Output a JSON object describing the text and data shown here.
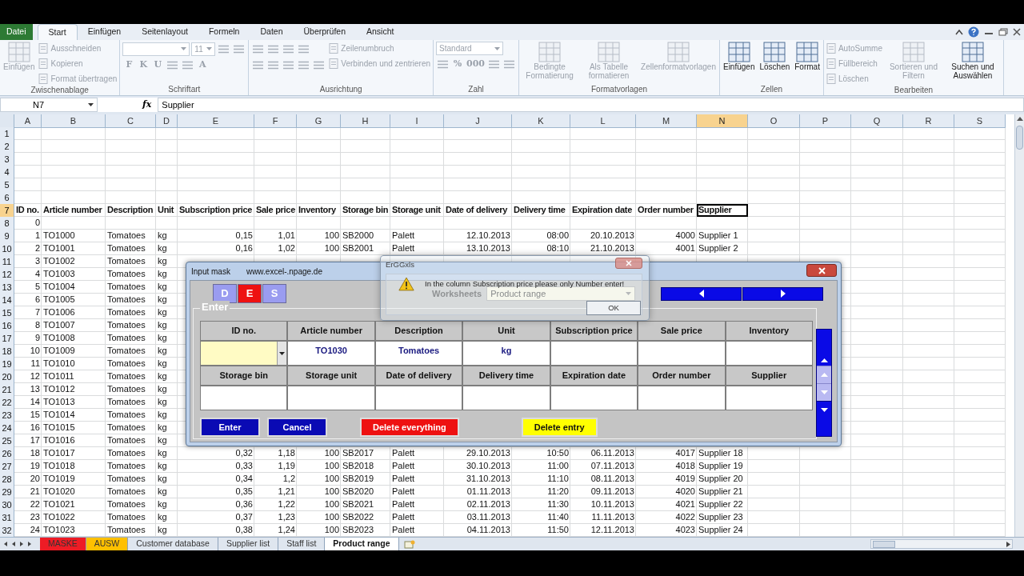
{
  "ribbon": {
    "tabs": [
      {
        "label": "Datei",
        "kind": "file",
        "selected": false
      },
      {
        "label": "Start",
        "kind": "tab",
        "selected": true
      },
      {
        "label": "Einfügen",
        "kind": "tab",
        "selected": false
      },
      {
        "label": "Seitenlayout",
        "kind": "tab",
        "selected": false
      },
      {
        "label": "Formeln",
        "kind": "tab",
        "selected": false
      },
      {
        "label": "Daten",
        "kind": "tab",
        "selected": false
      },
      {
        "label": "Überprüfen",
        "kind": "tab",
        "selected": false
      },
      {
        "label": "Ansicht",
        "kind": "tab",
        "selected": false
      }
    ],
    "groups": [
      {
        "name": "Zwischenablage",
        "columns": [
          [
            [
              {
                "kind": "large",
                "label": "Einfügen",
                "disabled": true
              }
            ]
          ],
          [
            [
              {
                "kind": "small",
                "label": "Ausschneiden",
                "disabled": true
              }
            ],
            [
              {
                "kind": "small",
                "label": "Kopieren",
                "disabled": true
              }
            ],
            [
              {
                "kind": "small",
                "label": "Format übertragen",
                "disabled": true
              }
            ]
          ]
        ]
      },
      {
        "name": "Schriftart",
        "columns": [
          [
            [
              {
                "kind": "combo",
                "disabled": true
              },
              {
                "kind": "short_combo",
                "value": "11",
                "disabled": true
              },
              {
                "kind": "iconbtn",
                "disabled": true
              },
              {
                "kind": "iconbtn",
                "disabled": true
              }
            ],
            [
              {
                "kind": "glyph",
                "label": "F",
                "disabled": true
              },
              {
                "kind": "glyph",
                "label": "K",
                "disabled": true
              },
              {
                "kind": "glyph",
                "label": "U",
                "disabled": true
              },
              {
                "kind": "iconbtn",
                "disabled": true
              },
              {
                "kind": "iconbtn",
                "disabled": true
              },
              {
                "kind": "glyph",
                "label": "A",
                "disabled": true
              }
            ]
          ]
        ]
      },
      {
        "name": "Ausrichtung",
        "columns": [
          [
            [
              {
                "kind": "iconbtn",
                "disabled": true
              },
              {
                "kind": "iconbtn",
                "disabled": true
              },
              {
                "kind": "iconbtn",
                "disabled": true
              },
              {
                "kind": "iconbtn",
                "disabled": true
              }
            ],
            [
              {
                "kind": "iconbtn",
                "disabled": true
              },
              {
                "kind": "iconbtn",
                "disabled": true
              },
              {
                "kind": "iconbtn",
                "disabled": true
              },
              {
                "kind": "iconbtn",
                "disabled": true
              },
              {
                "kind": "iconbtn",
                "disabled": true
              }
            ]
          ],
          [
            [
              {
                "kind": "small",
                "label": "Zeilenumbruch",
                "disabled": true
              }
            ],
            [
              {
                "kind": "small",
                "label": "Verbinden und zentrieren",
                "disabled": true
              }
            ]
          ]
        ]
      },
      {
        "name": "Zahl",
        "columns": [
          [
            [
              {
                "kind": "combo",
                "value": "Standard",
                "disabled": true
              }
            ],
            [
              {
                "kind": "iconbtn",
                "disabled": true
              },
              {
                "kind": "glyph",
                "label": "%",
                "disabled": true
              },
              {
                "kind": "glyph",
                "label": "000",
                "disabled": true
              },
              {
                "kind": "iconbtn",
                "disabled": true
              },
              {
                "kind": "iconbtn",
                "disabled": true
              }
            ]
          ]
        ]
      },
      {
        "name": "Formatvorlagen",
        "columns": [
          [
            [
              {
                "kind": "large",
                "label": "Bedingte Formatierung",
                "disabled": true
              }
            ]
          ],
          [
            [
              {
                "kind": "large",
                "label": "Als Tabelle formatieren",
                "disabled": true
              }
            ]
          ],
          [
            [
              {
                "kind": "large",
                "label": "Zellenformatvorlagen",
                "disabled": true
              }
            ]
          ]
        ]
      },
      {
        "name": "Zellen",
        "columns": [
          [
            [
              {
                "kind": "large",
                "label": "Einfügen",
                "disabled": false
              }
            ]
          ],
          [
            [
              {
                "kind": "large",
                "label": "Löschen",
                "disabled": false
              }
            ]
          ],
          [
            [
              {
                "kind": "large",
                "label": "Format",
                "disabled": false
              }
            ]
          ]
        ]
      },
      {
        "name": "Bearbeiten",
        "columns": [
          [
            [
              {
                "kind": "small",
                "label": "AutoSumme",
                "disabled": true
              }
            ],
            [
              {
                "kind": "small",
                "label": "Füllbereich",
                "disabled": true
              }
            ],
            [
              {
                "kind": "small",
                "label": "Löschen",
                "disabled": true
              }
            ]
          ],
          [
            [
              {
                "kind": "large",
                "label": "Sortieren und Filtern",
                "disabled": true
              }
            ]
          ],
          [
            [
              {
                "kind": "large",
                "label": "Suchen und Auswählen",
                "disabled": false
              }
            ]
          ]
        ]
      }
    ]
  },
  "formula_bar": {
    "name_box": "N7",
    "function_label": "fx",
    "content": "Supplier"
  },
  "sheet": {
    "columns": [
      {
        "label": "A",
        "selected": false
      },
      {
        "label": "B",
        "selected": false
      },
      {
        "label": "C",
        "selected": false
      },
      {
        "label": "D",
        "selected": false
      },
      {
        "label": "E",
        "selected": false
      },
      {
        "label": "F",
        "selected": false
      },
      {
        "label": "G",
        "selected": false
      },
      {
        "label": "H",
        "selected": false
      },
      {
        "label": "I",
        "selected": false
      },
      {
        "label": "J",
        "selected": false
      },
      {
        "label": "K",
        "selected": false
      },
      {
        "label": "L",
        "selected": false
      },
      {
        "label": "M",
        "selected": false
      },
      {
        "label": "N",
        "selected": true
      },
      {
        "label": "O",
        "selected": false
      },
      {
        "label": "P",
        "selected": false
      },
      {
        "label": "Q",
        "selected": false
      },
      {
        "label": "R",
        "selected": false
      },
      {
        "label": "S",
        "selected": false
      }
    ],
    "rows": [
      {
        "number": "1",
        "kind": "data",
        "selected": false
      },
      {
        "number": "2",
        "kind": "data",
        "selected": false
      },
      {
        "number": "3",
        "kind": "data",
        "selected": false
      },
      {
        "number": "4",
        "kind": "data",
        "selected": false
      },
      {
        "number": "5",
        "kind": "data",
        "selected": false
      },
      {
        "number": "6",
        "kind": "data",
        "selected": false
      },
      {
        "number": "7",
        "kind": "header",
        "selected": true,
        "cells": [
          "ID no.",
          "Article number",
          "Description",
          "Unit",
          "Subscription price",
          "Sale price",
          "Inventory",
          "Storage bin",
          "Storage unit",
          "Date of delivery",
          "Delivery time",
          "Expiration date",
          "Order number",
          "Supplier"
        ]
      },
      {
        "number": "8",
        "kind": "data",
        "selected": false,
        "cells": [
          "0"
        ]
      },
      {
        "number": "9",
        "kind": "data",
        "selected": false,
        "cells": [
          "1",
          "TO1000",
          "Tomatoes",
          "kg",
          "0,15",
          "1,01",
          "100",
          "SB2000",
          "Palett",
          "12.10.2013",
          "08:00",
          "20.10.2013",
          "4000",
          "Supplier 1"
        ]
      },
      {
        "number": "10",
        "kind": "data",
        "selected": false,
        "cells": [
          "2",
          "TO1001",
          "Tomatoes",
          "kg",
          "0,16",
          "1,02",
          "100",
          "SB2001",
          "Palett",
          "13.10.2013",
          "08:10",
          "21.10.2013",
          "4001",
          "Supplier 2"
        ]
      },
      {
        "number": "11",
        "kind": "data",
        "selected": false,
        "cells": [
          "3",
          "TO1002",
          "Tomatoes",
          "kg"
        ]
      },
      {
        "number": "12",
        "kind": "data",
        "selected": false,
        "cells": [
          "4",
          "TO1003",
          "Tomatoes",
          "kg"
        ]
      },
      {
        "number": "13",
        "kind": "data",
        "selected": false,
        "cells": [
          "5",
          "TO1004",
          "Tomatoes",
          "kg"
        ]
      },
      {
        "number": "14",
        "kind": "data",
        "selected": false,
        "cells": [
          "6",
          "TO1005",
          "Tomatoes",
          "kg"
        ]
      },
      {
        "number": "15",
        "kind": "data",
        "selected": false,
        "cells": [
          "7",
          "TO1006",
          "Tomatoes",
          "kg"
        ]
      },
      {
        "number": "16",
        "kind": "data",
        "selected": false,
        "cells": [
          "8",
          "TO1007",
          "Tomatoes",
          "kg"
        ]
      },
      {
        "number": "17",
        "kind": "data",
        "selected": false,
        "cells": [
          "9",
          "TO1008",
          "Tomatoes",
          "kg"
        ]
      },
      {
        "number": "18",
        "kind": "data",
        "selected": false,
        "cells": [
          "10",
          "TO1009",
          "Tomatoes",
          "kg"
        ]
      },
      {
        "number": "19",
        "kind": "data",
        "selected": false,
        "cells": [
          "11",
          "TO1010",
          "Tomatoes",
          "kg"
        ]
      },
      {
        "number": "20",
        "kind": "data",
        "selected": false,
        "cells": [
          "12",
          "TO1011",
          "Tomatoes",
          "kg"
        ]
      },
      {
        "number": "21",
        "kind": "data",
        "selected": false,
        "cells": [
          "13",
          "TO1012",
          "Tomatoes",
          "kg"
        ]
      },
      {
        "number": "22",
        "kind": "data",
        "selected": false,
        "cells": [
          "14",
          "TO1013",
          "Tomatoes",
          "kg"
        ]
      },
      {
        "number": "23",
        "kind": "data",
        "selected": false,
        "cells": [
          "15",
          "TO1014",
          "Tomatoes",
          "kg"
        ]
      },
      {
        "number": "24",
        "kind": "data",
        "selected": false,
        "cells": [
          "16",
          "TO1015",
          "Tomatoes",
          "kg"
        ]
      },
      {
        "number": "25",
        "kind": "data",
        "selected": false,
        "cells": [
          "17",
          "TO1016",
          "Tomatoes",
          "kg"
        ]
      },
      {
        "number": "26",
        "kind": "data",
        "selected": false,
        "cells": [
          "18",
          "TO1017",
          "Tomatoes",
          "kg",
          "0,32",
          "1,18",
          "100",
          "SB2017",
          "Palett",
          "29.10.2013",
          "10:50",
          "06.11.2013",
          "4017",
          "Supplier 18"
        ]
      },
      {
        "number": "27",
        "kind": "data",
        "selected": false,
        "cells": [
          "19",
          "TO1018",
          "Tomatoes",
          "kg",
          "0,33",
          "1,19",
          "100",
          "SB2018",
          "Palett",
          "30.10.2013",
          "11:00",
          "07.11.2013",
          "4018",
          "Supplier 19"
        ]
      },
      {
        "number": "28",
        "kind": "data",
        "selected": false,
        "cells": [
          "20",
          "TO1019",
          "Tomatoes",
          "kg",
          "0,34",
          "1,2",
          "100",
          "SB2019",
          "Palett",
          "31.10.2013",
          "11:10",
          "08.11.2013",
          "4019",
          "Supplier 20"
        ]
      },
      {
        "number": "29",
        "kind": "data",
        "selected": false,
        "cells": [
          "21",
          "TO1020",
          "Tomatoes",
          "kg",
          "0,35",
          "1,21",
          "100",
          "SB2020",
          "Palett",
          "01.11.2013",
          "11:20",
          "09.11.2013",
          "4020",
          "Supplier 21"
        ]
      },
      {
        "number": "30",
        "kind": "data",
        "selected": false,
        "cells": [
          "22",
          "TO1021",
          "Tomatoes",
          "kg",
          "0,36",
          "1,22",
          "100",
          "SB2021",
          "Palett",
          "02.11.2013",
          "11:30",
          "10.11.2013",
          "4021",
          "Supplier 22"
        ]
      },
      {
        "number": "31",
        "kind": "data",
        "selected": false,
        "cells": [
          "23",
          "TO1022",
          "Tomatoes",
          "kg",
          "0,37",
          "1,23",
          "100",
          "SB2022",
          "Palett",
          "03.11.2013",
          "11:40",
          "11.11.2013",
          "4022",
          "Supplier 23"
        ]
      },
      {
        "number": "32",
        "kind": "data",
        "selected": false,
        "cells": [
          "24",
          "TO1023",
          "Tomatoes",
          "kg",
          "0,38",
          "1,24",
          "100",
          "SB2023",
          "Palett",
          "04.11.2013",
          "11:50",
          "12.11.2013",
          "4023",
          "Supplier 24"
        ]
      }
    ]
  },
  "sheet_tabs": [
    {
      "label": "MASKE",
      "selected": false,
      "color": "#ee1c25"
    },
    {
      "label": "AUSW",
      "selected": false,
      "color": "#ffc000"
    },
    {
      "label": "Customer database",
      "selected": false
    },
    {
      "label": "Supplier list",
      "selected": false
    },
    {
      "label": "Staff list",
      "selected": false
    },
    {
      "label": "Product range",
      "selected": true
    }
  ],
  "input_mask": {
    "title": "Input mask",
    "website": "www.excel-.npage.de",
    "languages": [
      {
        "label": "D",
        "selected": false
      },
      {
        "label": "E",
        "selected": true
      },
      {
        "label": "S",
        "selected": false
      }
    ],
    "worksheet_label": "Worksheets",
    "worksheet_value": "Product range",
    "frame_title": "Enter",
    "fields": [
      {
        "label": "ID no.",
        "kind": "combo"
      },
      {
        "label": "Article number",
        "kind": "text",
        "value": "TO1030"
      },
      {
        "label": "Description",
        "kind": "text",
        "value": "Tomatoes"
      },
      {
        "label": "Unit",
        "kind": "text",
        "value": "kg"
      },
      {
        "label": "Subscription price",
        "kind": "text"
      },
      {
        "label": "Sale price",
        "kind": "text"
      },
      {
        "label": "Inventory",
        "kind": "text"
      },
      {
        "label": "Storage bin",
        "kind": "text"
      },
      {
        "label": "Storage unit",
        "kind": "text"
      },
      {
        "label": "Date of delivery",
        "kind": "text"
      },
      {
        "label": "Delivery time",
        "kind": "text"
      },
      {
        "label": "Expiration date",
        "kind": "text"
      },
      {
        "label": "Order number",
        "kind": "text"
      },
      {
        "label": "Supplier",
        "kind": "text"
      }
    ],
    "buttons": [
      {
        "label": "Enter",
        "color": "#0a0ab4"
      },
      {
        "label": "Cancel",
        "color": "#0a0ab4"
      },
      {
        "label": "Delete everything",
        "color": "#ee1111"
      },
      {
        "label": "Delete entry",
        "color": "#ffff00"
      }
    ]
  },
  "error_dialog": {
    "title": "ErGGxls",
    "message": "In the column Subscription price please only Number enter!",
    "button": "OK"
  }
}
